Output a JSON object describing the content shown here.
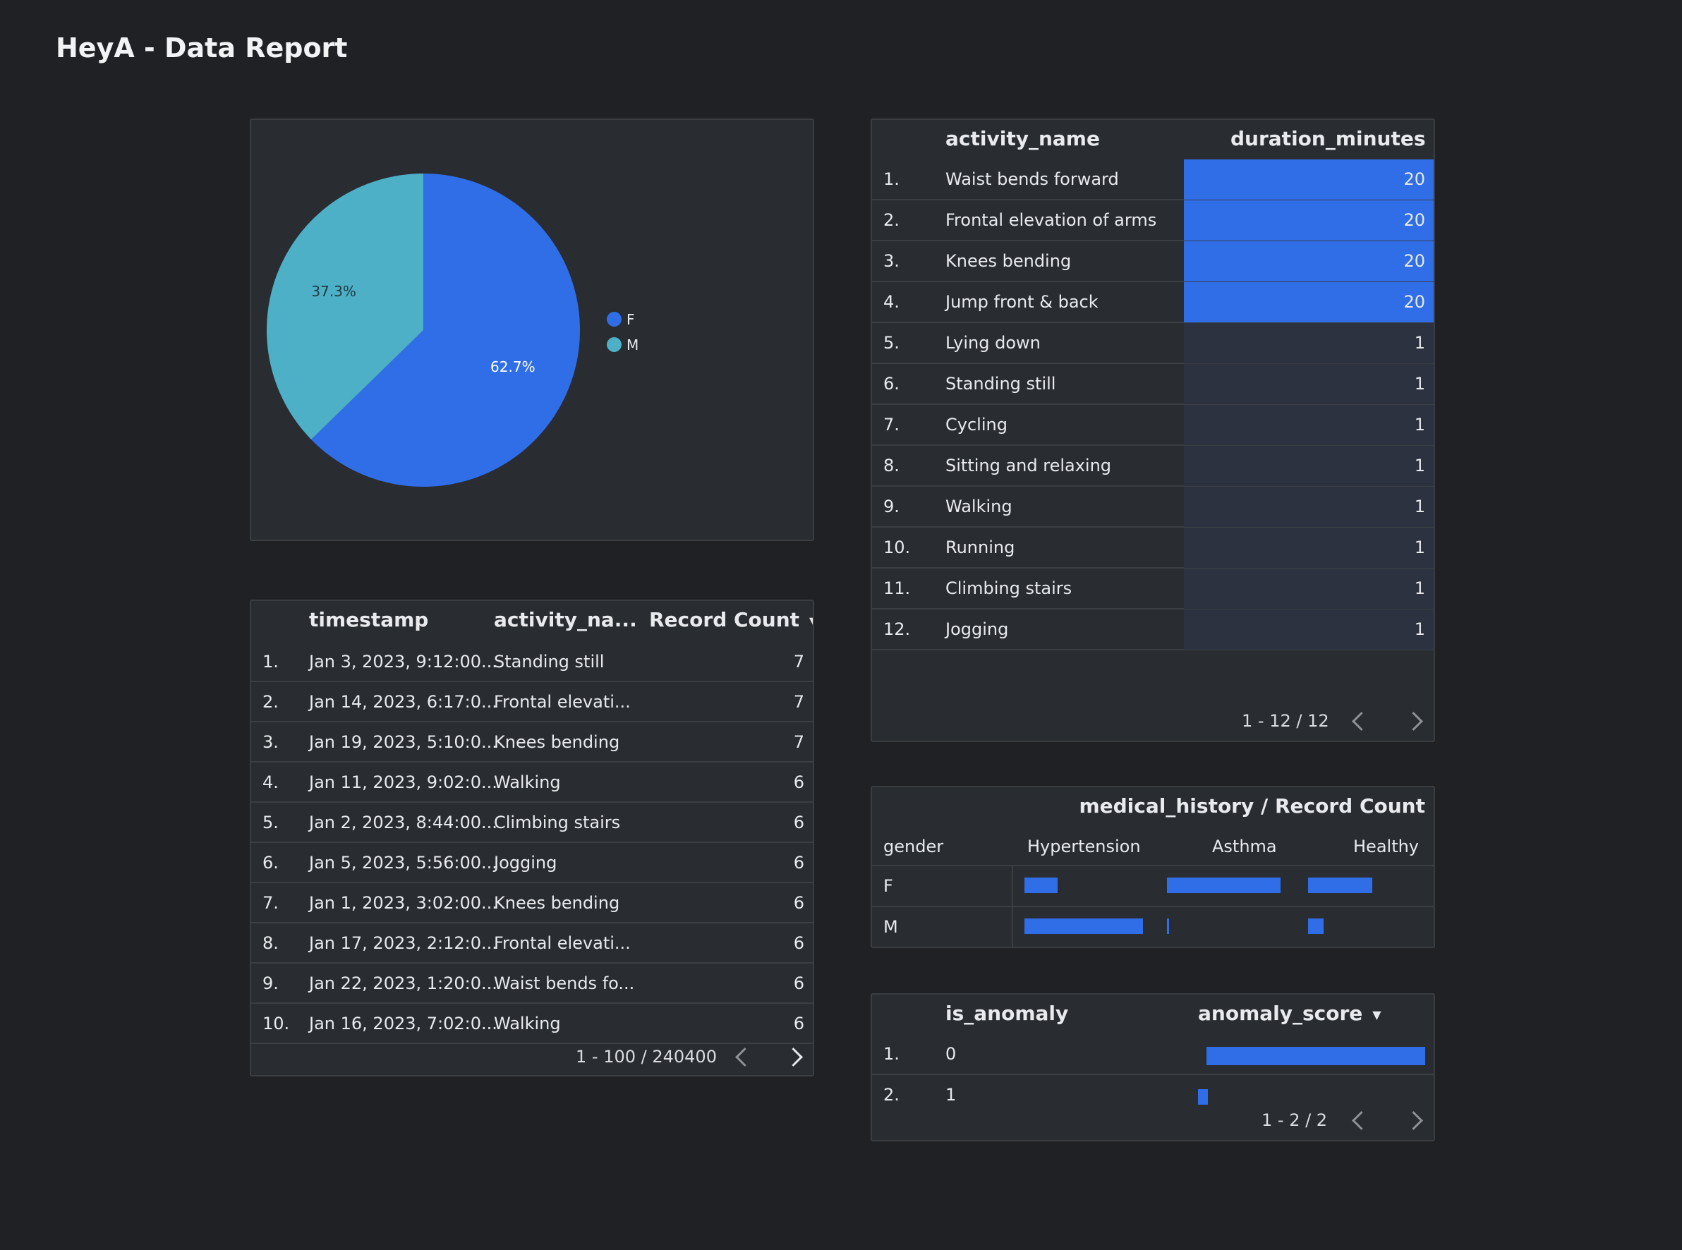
{
  "report": {
    "title": "HeyA - Data Report"
  },
  "pie": {
    "legend": [
      {
        "label": "F",
        "color": "#306ee8"
      },
      {
        "label": "M",
        "color": "#4db0c6"
      }
    ],
    "labels": {
      "f": "62.7%",
      "m": "37.3%"
    }
  },
  "chart_data": {
    "type": "pie",
    "labels": [
      "F",
      "M"
    ],
    "values": [
      62.7,
      37.3
    ],
    "colors": [
      "#306ee8",
      "#4db0c6"
    ],
    "legend": "right"
  },
  "timestamp_table": {
    "headers": {
      "timestamp": "timestamp",
      "activity": "activity_na...",
      "count": "Record Count"
    },
    "rows": [
      {
        "n": "1.",
        "ts": "Jan 3, 2023, 9:12:00...",
        "act": "Standing still",
        "count": "7"
      },
      {
        "n": "2.",
        "ts": "Jan 14, 2023, 6:17:0...",
        "act": "Frontal elevati...",
        "count": "7"
      },
      {
        "n": "3.",
        "ts": "Jan 19, 2023, 5:10:0...",
        "act": "Knees bending",
        "count": "7"
      },
      {
        "n": "4.",
        "ts": "Jan 11, 2023, 9:02:0...",
        "act": "Walking",
        "count": "6"
      },
      {
        "n": "5.",
        "ts": "Jan 2, 2023, 8:44:00...",
        "act": "Climbing stairs",
        "count": "6"
      },
      {
        "n": "6.",
        "ts": "Jan 5, 2023, 5:56:00...",
        "act": "Jogging",
        "count": "6"
      },
      {
        "n": "7.",
        "ts": "Jan 1, 2023, 3:02:00...",
        "act": "Knees bending",
        "count": "6"
      },
      {
        "n": "8.",
        "ts": "Jan 17, 2023, 2:12:0...",
        "act": "Frontal elevati...",
        "count": "6"
      },
      {
        "n": "9.",
        "ts": "Jan 22, 2023, 1:20:0...",
        "act": "Waist bends fo...",
        "count": "6"
      },
      {
        "n": "10.",
        "ts": "Jan 16, 2023, 7:02:0...",
        "act": "Walking",
        "count": "6"
      }
    ],
    "pager": "1 - 100 / 240400"
  },
  "activity_table": {
    "headers": {
      "name": "activity_name",
      "duration": "duration_minutes"
    },
    "rows": [
      {
        "n": "1.",
        "name": "Waist bends forward",
        "duration": "20"
      },
      {
        "n": "2.",
        "name": "Frontal elevation of arms",
        "duration": "20"
      },
      {
        "n": "3.",
        "name": "Knees bending",
        "duration": "20"
      },
      {
        "n": "4.",
        "name": "Jump front & back",
        "duration": "20"
      },
      {
        "n": "5.",
        "name": "Lying down",
        "duration": "1"
      },
      {
        "n": "6.",
        "name": "Standing still",
        "duration": "1"
      },
      {
        "n": "7.",
        "name": "Cycling",
        "duration": "1"
      },
      {
        "n": "8.",
        "name": "Sitting and relaxing",
        "duration": "1"
      },
      {
        "n": "9.",
        "name": "Walking",
        "duration": "1"
      },
      {
        "n": "10.",
        "name": "Running",
        "duration": "1"
      },
      {
        "n": "11.",
        "name": "Climbing stairs",
        "duration": "1"
      },
      {
        "n": "12.",
        "name": "Jogging",
        "duration": "1"
      }
    ],
    "pager": "1 - 12 / 12"
  },
  "medical_pivot": {
    "title": "medical_history / Record Count",
    "row_header": "gender",
    "columns": [
      "Hypertension",
      "Asthma",
      "Healthy"
    ],
    "rows": [
      {
        "label": "F",
        "values": [
          0.28,
          0.97,
          0.55
        ]
      },
      {
        "label": "M",
        "values": [
          1.0,
          0.02,
          0.13
        ]
      }
    ]
  },
  "anomaly_table": {
    "headers": {
      "flag": "is_anomaly",
      "score": "anomaly_score"
    },
    "rows": [
      {
        "n": "1.",
        "flag": "0",
        "score": 1.0
      },
      {
        "n": "2.",
        "flag": "1",
        "score": 0.04
      }
    ],
    "pager": "1 - 2 / 2"
  }
}
